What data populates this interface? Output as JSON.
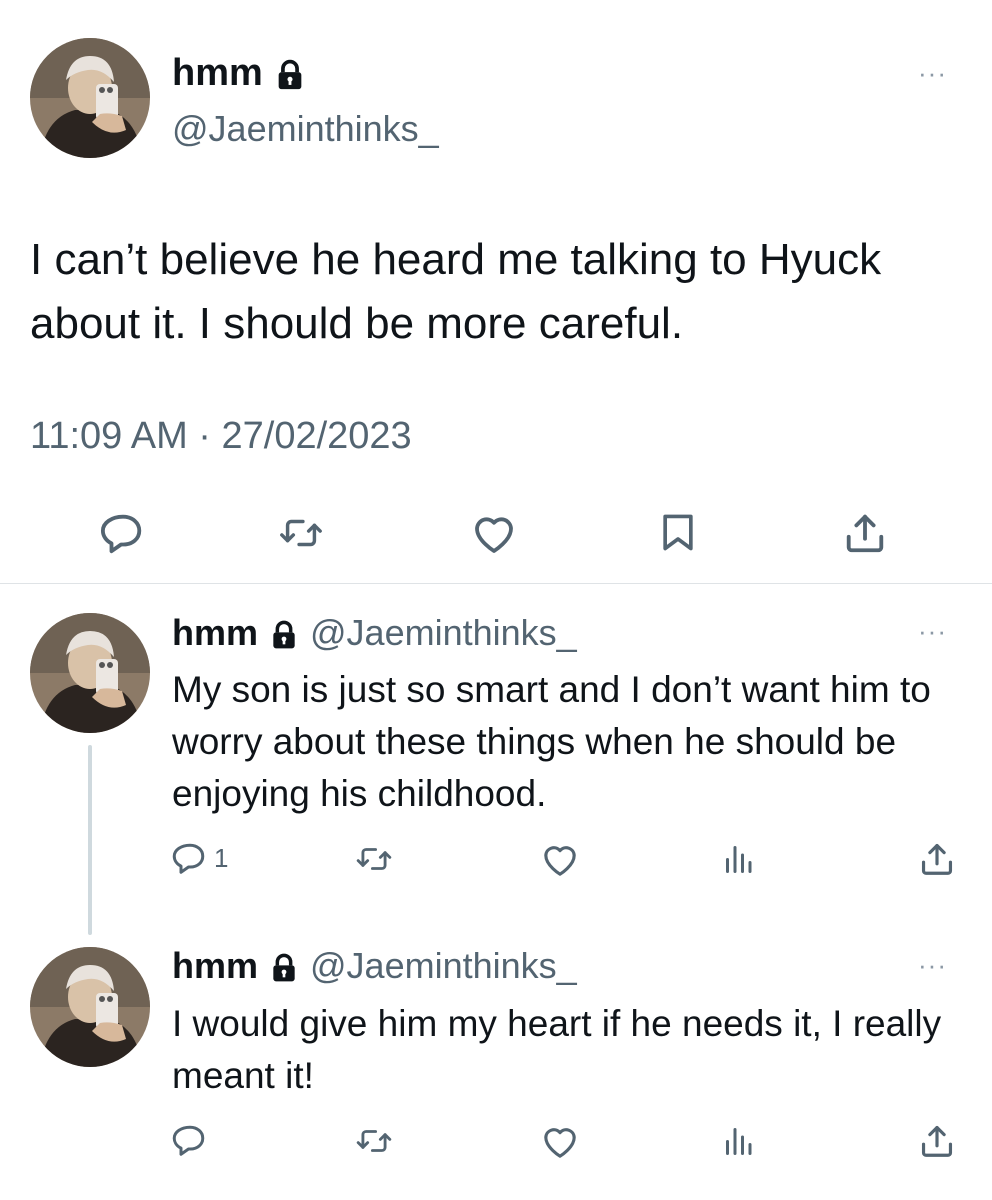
{
  "main_tweet": {
    "display_name": "hmm",
    "handle": "@Jaeminthinks_",
    "text": "I can’t believe he heard me talking to Hyuck about it. I should be more careful.",
    "timestamp": "11:09 AM · 27/02/2023",
    "more_label": "···"
  },
  "replies": [
    {
      "display_name": "hmm",
      "handle": "@Jaeminthinks_",
      "text": "My son is just so smart and I don’t want him to worry about these things when he should be enjoying his childhood.",
      "reply_count": "1",
      "more_label": "···"
    },
    {
      "display_name": "hmm",
      "handle": "@Jaeminthinks_",
      "text": "I would give him my heart if he needs it, I really meant it!",
      "reply_count": "",
      "more_label": "···"
    }
  ],
  "colors": {
    "text_primary": "#0f1419",
    "text_secondary": "#536471",
    "icon": "#536471",
    "divider": "#dfe3e6"
  },
  "icons": [
    "lock-icon",
    "reply-icon",
    "retweet-icon",
    "like-icon",
    "bookmark-icon",
    "share-icon",
    "views-icon",
    "more-icon"
  ]
}
